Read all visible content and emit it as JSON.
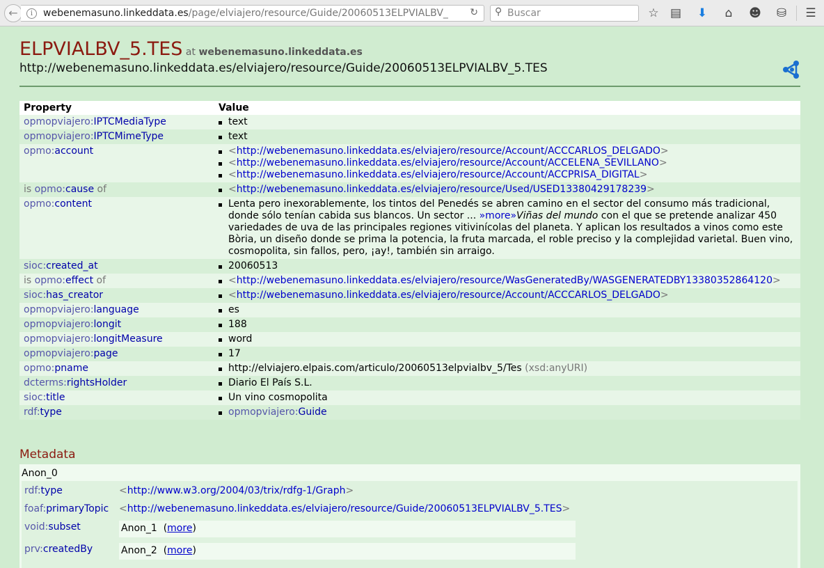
{
  "browser": {
    "url_host": "webenemasuno.linkeddata.es",
    "url_path": "/page/elviajero/resource/Guide/20060513ELPVIALBV_",
    "search_placeholder": "Buscar"
  },
  "header": {
    "title": "ELPVIALBV_5.TES",
    "at": "at",
    "site": "webenemasuno.linkeddata.es",
    "uri": "http://webenemasuno.linkeddata.es/elviajero/resource/Guide/20060513ELPVIALBV_5.TES"
  },
  "table": {
    "col_property": "Property",
    "col_value": "Value",
    "rows": [
      {
        "is": "",
        "prefix": "opmopviajero:",
        "local": "IPTCMediaType",
        "of": "",
        "values": [
          {
            "text": "text"
          }
        ]
      },
      {
        "is": "",
        "prefix": "opmopviajero:",
        "local": "IPTCMimeType",
        "of": "",
        "values": [
          {
            "text": "text"
          }
        ]
      },
      {
        "is": "",
        "prefix": "opmo:",
        "local": "account",
        "of": "",
        "values": [
          {
            "link": "http://webenemasuno.linkeddata.es/elviajero/resource/Account/ACCCARLOS_DELGADO"
          },
          {
            "link": "http://webenemasuno.linkeddata.es/elviajero/resource/Account/ACCELENA_SEVILLANO"
          },
          {
            "link": "http://webenemasuno.linkeddata.es/elviajero/resource/Account/ACCPRISA_DIGITAL"
          }
        ]
      },
      {
        "is": "is ",
        "prefix": "opmo:",
        "local": "cause",
        "of": " of",
        "values": [
          {
            "link": "http://webenemasuno.linkeddata.es/elviajero/resource/Used/USED13380429178239"
          }
        ]
      },
      {
        "is": "",
        "prefix": "opmo:",
        "local": "content",
        "of": "",
        "values": [
          {
            "rich": true,
            "pre": "Lenta pero inexorablemente, los tintos del Penedés se abren camino en el sector del consumo más tradicional, donde sólo tenían cabida sus blancos. Un sector ... ",
            "more": "»more»",
            "italic": "Viñas del mundo",
            "post": " con el que se pretende analizar 450 variedades de uva de las principales regiones vitivinícolas del planeta. Y aplican los resultados a vinos como este Bòria, un diseño donde se prima la potencia, la fruta marcada, el roble preciso y la complejidad varietal. Buen vino, cosmopolita, sin fallos, pero, ¡ay!, también sin arraigo."
          }
        ]
      },
      {
        "is": "",
        "prefix": "sioc:",
        "local": "created_at",
        "of": "",
        "values": [
          {
            "text": "20060513"
          }
        ]
      },
      {
        "is": "is ",
        "prefix": "opmo:",
        "local": "effect",
        "of": " of",
        "values": [
          {
            "link": "http://webenemasuno.linkeddata.es/elviajero/resource/WasGeneratedBy/WASGENERATEDBY13380352864120"
          }
        ]
      },
      {
        "is": "",
        "prefix": "sioc:",
        "local": "has_creator",
        "of": "",
        "values": [
          {
            "link": "http://webenemasuno.linkeddata.es/elviajero/resource/Account/ACCCARLOS_DELGADO"
          }
        ]
      },
      {
        "is": "",
        "prefix": "opmopviajero:",
        "local": "language",
        "of": "",
        "values": [
          {
            "text": "es"
          }
        ]
      },
      {
        "is": "",
        "prefix": "opmopviajero:",
        "local": "longit",
        "of": "",
        "values": [
          {
            "text": "188"
          }
        ]
      },
      {
        "is": "",
        "prefix": "opmopviajero:",
        "local": "longitMeasure",
        "of": "",
        "values": [
          {
            "text": "word"
          }
        ]
      },
      {
        "is": "",
        "prefix": "opmopviajero:",
        "local": "page",
        "of": "",
        "values": [
          {
            "text": "17"
          }
        ]
      },
      {
        "is": "",
        "prefix": "opmo:",
        "local": "pname",
        "of": "",
        "values": [
          {
            "text": "http://elviajero.elpais.com/articulo/20060513elpvialbv_5/Tes",
            "dtype": " (xsd:anyURI)"
          }
        ]
      },
      {
        "is": "",
        "prefix": "dcterms:",
        "local": "rightsHolder",
        "of": "",
        "values": [
          {
            "text": "Diario El País S.L."
          }
        ]
      },
      {
        "is": "",
        "prefix": "sioc:",
        "local": "title",
        "of": "",
        "values": [
          {
            "text": "Un vino cosmopolita"
          }
        ]
      },
      {
        "is": "",
        "prefix": "rdf:",
        "local": "type",
        "of": "",
        "values": [
          {
            "qname_prefix": "opmopviajero:",
            "qname_local": "Guide"
          }
        ]
      }
    ]
  },
  "metadata": {
    "title": "Metadata",
    "node": "Anon_0",
    "rdf_type": {
      "prefix": "rdf:",
      "local": "type",
      "value": "http://www.w3.org/2004/03/trix/rdfg-1/Graph"
    },
    "primary_topic": {
      "prefix": "foaf:",
      "local": "primaryTopic",
      "value": "http://webenemasuno.linkeddata.es/elviajero/resource/Guide/20060513ELPVIALBV_5.TES"
    },
    "subset": {
      "prefix": "void:",
      "local": "subset",
      "node": "Anon_1",
      "more": "more"
    },
    "created_by": {
      "prefix": "prv:",
      "local": "createdBy",
      "node": "Anon_2",
      "more": "more"
    }
  },
  "colors": {
    "title": "#8b1a10",
    "link": "#0000cc",
    "background": "#d0ecd0"
  }
}
